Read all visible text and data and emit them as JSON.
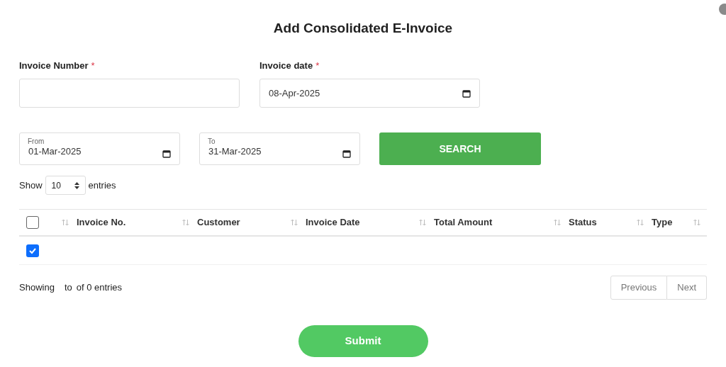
{
  "dialog": {
    "title": "Add Consolidated E-Invoice"
  },
  "fields": [
    {
      "label": "Invoice Number",
      "required_mark": "*"
    },
    {
      "label": "Invoice date",
      "required_mark": "*",
      "value": "08-Apr-2025"
    }
  ],
  "range": [
    {
      "label": "From",
      "value": "01-Mar-2025"
    },
    {
      "label": "To",
      "value": "31-Mar-2025"
    }
  ],
  "search_button": "SEARCH",
  "length": {
    "prefix": "Show",
    "value": "10",
    "suffix": "entries"
  },
  "table": {
    "header_checked": false,
    "columns": [
      "Invoice No.",
      "Customer",
      "Invoice Date",
      "Total Amount",
      "Status",
      "Type"
    ],
    "rows": [
      {
        "checked": true
      }
    ]
  },
  "info": [
    "Showing",
    "to",
    "of 0 entries"
  ],
  "pagination": [
    "Previous",
    "Next"
  ],
  "submit": "Submit"
}
